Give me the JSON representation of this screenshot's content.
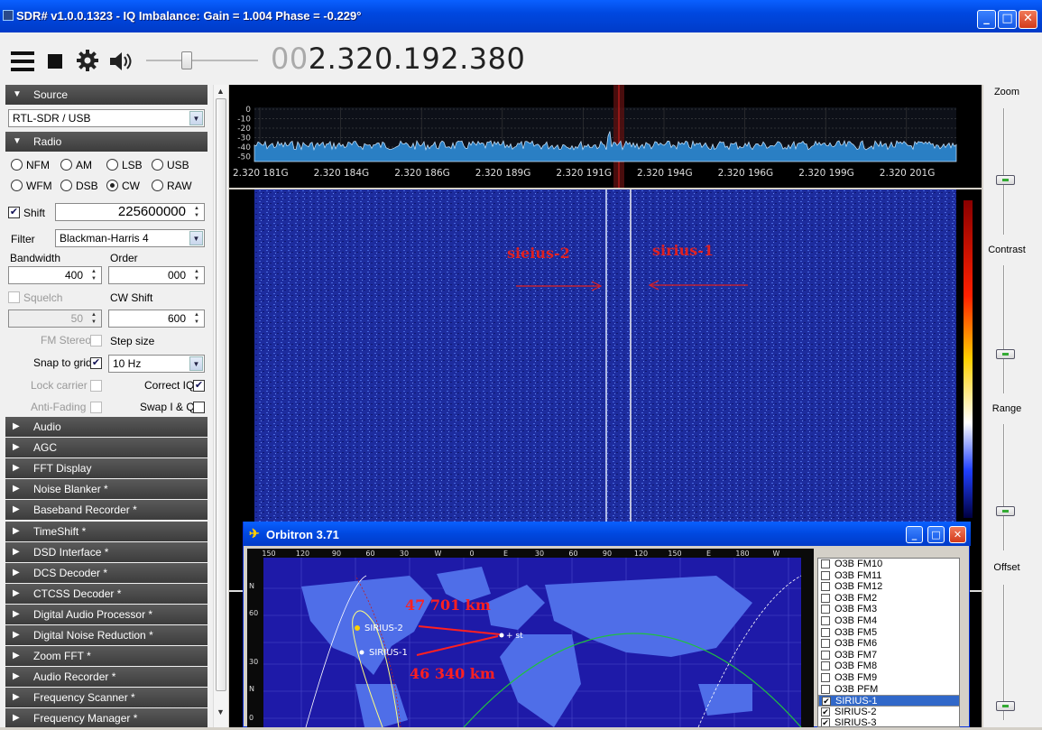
{
  "window": {
    "title": "SDR# v1.0.0.1323 - IQ Imbalance: Gain = 1.004 Phase = -0.229°",
    "controls": {
      "min": "_",
      "max": "□",
      "close": "✕"
    }
  },
  "toolbar": {
    "frequency_dim": "00",
    "frequency_main": "2.320.192.380"
  },
  "sections": {
    "source": "Source",
    "radio": "Radio",
    "collapsed": [
      "Audio",
      "AGC",
      "FFT Display",
      "Noise Blanker *",
      "Baseband Recorder *",
      "TimeShift *",
      "DSD Interface *",
      "DCS Decoder *",
      "CTCSS Decoder *",
      "Digital Audio Processor *",
      "Digital Noise Reduction *",
      "Zoom FFT *",
      "Audio Recorder *",
      "Frequency Scanner *",
      "Frequency Manager *"
    ]
  },
  "source": {
    "device": "RTL-SDR / USB"
  },
  "radio": {
    "modes_row1": [
      "NFM",
      "AM",
      "LSB",
      "USB"
    ],
    "modes_row2": [
      "WFM",
      "DSB",
      "CW",
      "RAW"
    ],
    "selected_mode": "CW",
    "shift_label": "Shift",
    "shift_checked": true,
    "shift_value": "225600000",
    "filter_label": "Filter",
    "filter_value": "Blackman-Harris 4",
    "bandwidth_label": "Bandwidth",
    "bandwidth_value": "400",
    "order_label": "Order",
    "order_value": "000",
    "squelch_label": "Squelch",
    "squelch_value": "50",
    "cwshift_label": "CW Shift",
    "cwshift_value": "600",
    "fmstereo_label": "FM Stereo",
    "stepsize_label": "Step size",
    "snap_label": "Snap to grid",
    "snap_checked": true,
    "step_value": "10 Hz",
    "lockcarrier_label": "Lock carrier",
    "correctiq_label": "Correct IQ",
    "correctiq_checked": true,
    "antifading_label": "Anti-Fading",
    "swapiq_label": "Swap I & Q"
  },
  "spectrum": {
    "db_ticks": [
      "0",
      "-10",
      "-20",
      "-30",
      "-40",
      "-50"
    ],
    "freq_ticks": [
      "2.320 181G",
      "2.320 184G",
      "2.320 186G",
      "2.320 189G",
      "2.320 191G",
      "2.320 194G",
      "2.320 196G",
      "2.320 199G",
      "2.320 201G"
    ]
  },
  "waterfall": {
    "annotations": [
      "sieius-2",
      "sirius-1"
    ]
  },
  "right_panel": {
    "zoom": "Zoom",
    "contrast": "Contrast",
    "range": "Range",
    "offset": "Offset"
  },
  "orbitron": {
    "title": "Orbitron 3.71",
    "lon_ticks": [
      "150",
      "120",
      "90",
      "60",
      "30",
      "W",
      "0",
      "E",
      "30",
      "60",
      "90",
      "120",
      "150",
      "E",
      "180",
      "W"
    ],
    "lat_ticks": [
      "N",
      "60",
      "30",
      "N",
      "0"
    ],
    "distance_1": "47 701 km",
    "distance_2": "46 340 km",
    "sat_labels": [
      "SIRIUS-2",
      "SIRIUS-1"
    ],
    "station": "st",
    "satellites": [
      {
        "name": "O3B FM10",
        "checked": false,
        "selected": false
      },
      {
        "name": "O3B FM11",
        "checked": false,
        "selected": false
      },
      {
        "name": "O3B FM12",
        "checked": false,
        "selected": false
      },
      {
        "name": "O3B FM2",
        "checked": false,
        "selected": false
      },
      {
        "name": "O3B FM3",
        "checked": false,
        "selected": false
      },
      {
        "name": "O3B FM4",
        "checked": false,
        "selected": false
      },
      {
        "name": "O3B FM5",
        "checked": false,
        "selected": false
      },
      {
        "name": "O3B FM6",
        "checked": false,
        "selected": false
      },
      {
        "name": "O3B FM7",
        "checked": false,
        "selected": false
      },
      {
        "name": "O3B FM8",
        "checked": false,
        "selected": false
      },
      {
        "name": "O3B FM9",
        "checked": false,
        "selected": false
      },
      {
        "name": "O3B PFM",
        "checked": false,
        "selected": false
      },
      {
        "name": "SIRIUS-1",
        "checked": true,
        "selected": true
      },
      {
        "name": "SIRIUS-2",
        "checked": true,
        "selected": false
      },
      {
        "name": "SIRIUS-3",
        "checked": true,
        "selected": false
      }
    ]
  },
  "colors": {
    "accent_xp_blue": "#0048e0",
    "waterfall_bg": "#1a2a9a",
    "annotation_red": "#e02020",
    "spectrum_fill": "#2a7fc4"
  }
}
